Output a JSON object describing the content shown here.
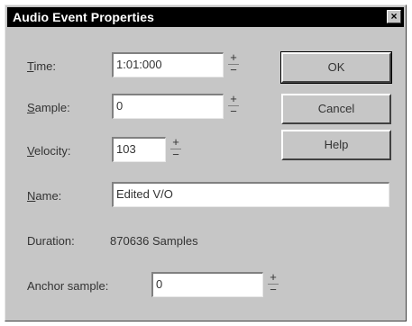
{
  "window": {
    "title": "Audio Event Properties",
    "close_glyph": "×"
  },
  "fields": {
    "time": {
      "label_prefix": "",
      "accel": "T",
      "label_rest": "ime:",
      "value": "1:01:000"
    },
    "sample": {
      "accel": "S",
      "label_rest": "ample:",
      "value": "0"
    },
    "velocity": {
      "accel": "V",
      "label_rest": "elocity:",
      "value": "103"
    },
    "name": {
      "accel": "N",
      "label_rest": "ame:",
      "value": "Edited V/O"
    },
    "duration": {
      "label": "Duration:",
      "value": "870636 Samples"
    },
    "anchor": {
      "label": "Anchor sample:",
      "value": "0"
    }
  },
  "spinner": {
    "up": "+",
    "down": "−"
  },
  "buttons": {
    "ok": "OK",
    "cancel": "Cancel",
    "help": "Help"
  }
}
